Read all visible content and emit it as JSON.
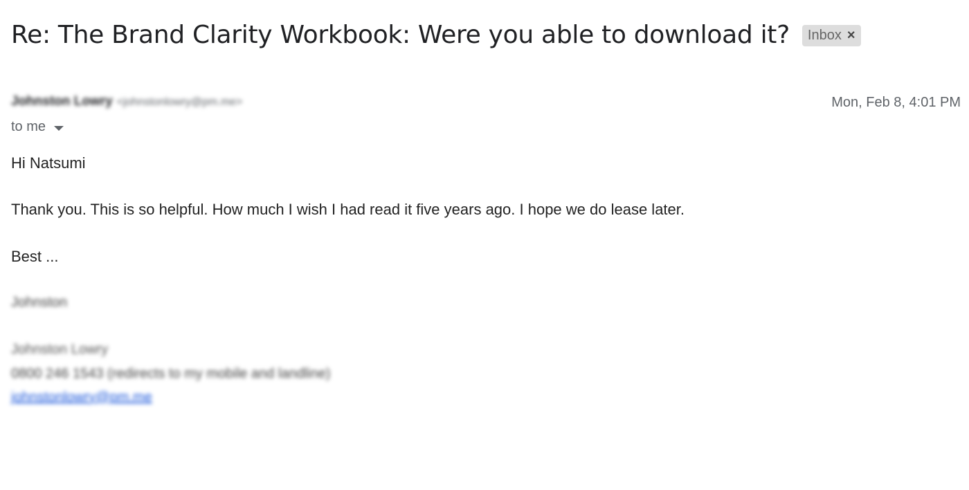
{
  "email": {
    "subject": "Re: The Brand Clarity Workbook: Were you able to download it?",
    "label": "Inbox",
    "label_close": "×",
    "sender_name": "Johnston Lowry",
    "sender_email": "<johnstonlowry@pm.me>",
    "date": "Mon, Feb 8, 4:01 PM",
    "recipient": "to me",
    "body": {
      "greeting": "Hi Natsumi",
      "message": "Thank you. This is so helpful. How much I wish I had read it five years ago. I hope we do lease later.",
      "signoff": "Best ...",
      "signature_first": "Johnston",
      "signature_full": "Johnston Lowry",
      "signature_phone": "0800 246 1543 (redirects to my mobile and landline)",
      "signature_email": "johnstonlowry@pm.me"
    }
  }
}
